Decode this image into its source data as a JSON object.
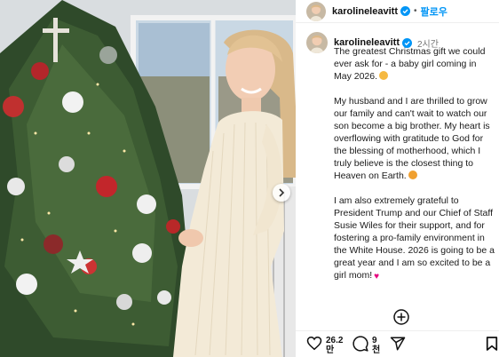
{
  "header": {
    "username": "karolineleavitt",
    "follow_label": "팔로우",
    "separator": "•"
  },
  "post": {
    "username": "karolineleavitt",
    "time_ago": "2시간",
    "caption_paragraphs": [
      "The greatest Christmas gift we could ever ask for - a baby girl coming in May 2026.",
      "My husband and I are thrilled to grow our family and can't wait to watch our son become a big brother. My heart is overflowing with gratitude to God for the blessing of motherhood, which I truly believe is the closest thing to Heaven on Earth.",
      "I am also extremely grateful to President Trump and our Chief of Staff Susie Wiles for their support, and for fostering a pro-family environment in the White House. 2026 is going to be a great year and I am so excited to be a girl mom!"
    ],
    "emojis": [
      "smiling-face-emoji",
      "smiling-tear-emoji",
      "pink-heart-emoji"
    ]
  },
  "actions": {
    "likes_line1": "26.2",
    "likes_line2": "만",
    "comments_line1": "9",
    "comments_line2": "천"
  },
  "icons": {
    "verified": "verified-badge-icon",
    "next": "chevron-right-icon",
    "add_comment": "add-circle-icon",
    "like": "heart-icon",
    "comment": "comment-bubble-icon",
    "share": "send-paper-plane-icon",
    "save": "bookmark-icon"
  },
  "colors": {
    "follow_blue": "#0095f6",
    "verified_blue": "#0095f6",
    "heart_pink": "#e6007e"
  }
}
